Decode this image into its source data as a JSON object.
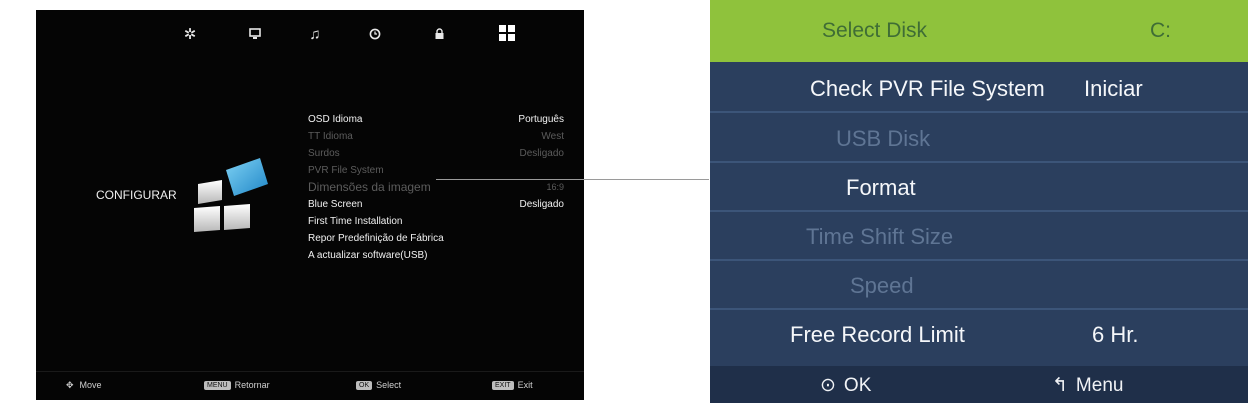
{
  "tv": {
    "top_icons": [
      "gear-icon",
      "monitor-icon",
      "music-icon",
      "clock-icon",
      "lock-icon",
      "grid-icon"
    ],
    "section_title": "CONFIGURAR",
    "menu": [
      {
        "label": "OSD Idioma",
        "value": "Português",
        "enabled": true
      },
      {
        "label": "TT Idioma",
        "value": "West",
        "enabled": false
      },
      {
        "label": "Surdos",
        "value": "Desligado",
        "enabled": false
      },
      {
        "label": "PVR File System",
        "value": "",
        "enabled": false
      },
      {
        "label": "Dimensões da imagem",
        "value": "16:9",
        "enabled": false
      },
      {
        "label": "Blue Screen",
        "value": "Desligado",
        "enabled": true
      },
      {
        "label": "First Time Installation",
        "value": "",
        "enabled": true
      },
      {
        "label": "Repor Predefinição de Fábrica",
        "value": "",
        "enabled": true
      },
      {
        "label": "A actualizar software(USB)",
        "value": "",
        "enabled": true
      }
    ],
    "hints": {
      "move": "Move",
      "menu_key": "MENU",
      "return": "Retornar",
      "ok_key": "OK",
      "select": "Select",
      "exit_key": "EXIT",
      "exit": "Exit"
    }
  },
  "panel": {
    "header": {
      "label": "Select Disk",
      "value": "C:"
    },
    "rows": [
      {
        "label": "Check PVR File System",
        "value": "Iniciar",
        "enabled": true
      },
      {
        "label": "USB Disk",
        "value": "",
        "enabled": false
      },
      {
        "label": "Format",
        "value": "",
        "enabled": true
      },
      {
        "label": "Time Shift Size",
        "value": "",
        "enabled": false
      },
      {
        "label": "Speed",
        "value": "",
        "enabled": false
      },
      {
        "label": "Free Record Limit",
        "value": "6 Hr.",
        "enabled": true
      }
    ],
    "footer": {
      "ok": "OK",
      "menu": "Menu"
    },
    "colors": {
      "header": "#8fc23c",
      "body": "#2b3f5e",
      "footer": "#1f2f49"
    }
  }
}
